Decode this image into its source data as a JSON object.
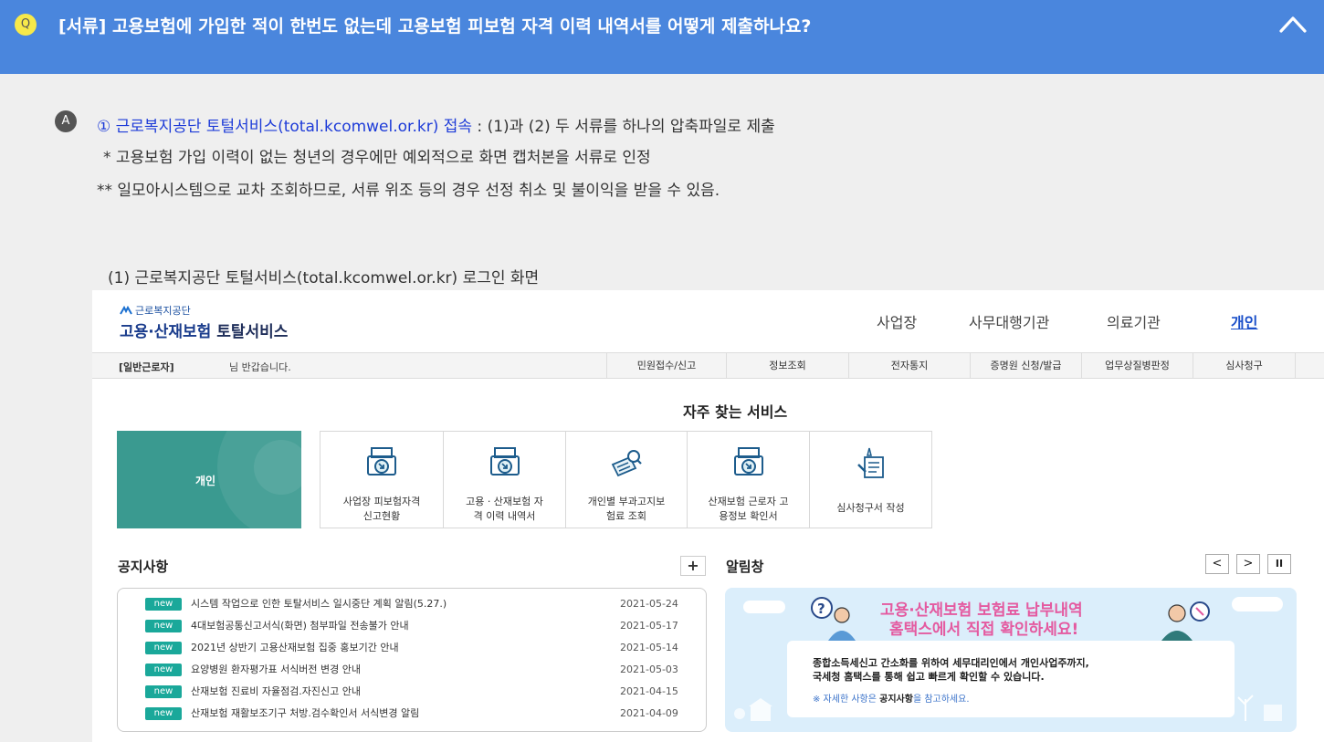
{
  "question": {
    "badge": "Q",
    "text": "[서류] 고용보험에 가입한 적이 한번도 없는데 고용보험 피보험 자격 이력 내역서를 어떻게 제출하나요?",
    "toggle_icon": "chevron-up-icon"
  },
  "answer": {
    "badge": "A",
    "line1_link": "① 근로복지공단 토털서비스(total.kcomwel.or.kr) 접속",
    "line1_rest": " : (1)과 (2) 두 서류를 하나의 압축파일로 제출",
    "line2": "* 고용보험 가입 이력이 없는 청년의 경우에만 예외적으로 화면 캡처본을 서류로 인정",
    "line3": "** 일모아시스템으로 교차 조회하므로, 서류 위조 등의 경우 선정 취소 및 불이익을 받을 수 있음.",
    "caption": "(1) 근로복지공단 토털서비스(total.kcomwel.or.kr) 로그인 화면"
  },
  "site": {
    "logo_small": "근로복지공단",
    "logo_main_a": "고용·산재보험",
    "logo_main_b": "토탈서비스",
    "top_nav": [
      "사업장",
      "사무대행기관",
      "의료기관",
      "개인"
    ],
    "greeting_user": "[일반근로자]",
    "greeting_text": "님 반갑습니다.",
    "menu": [
      "민원접수/신고",
      "정보조회",
      "전자통지",
      "증명원 신청/발급",
      "업무상질병판정",
      "심사청구"
    ],
    "services_title": "자주 찾는 서비스",
    "personal_label": "개인",
    "services": [
      {
        "line1": "사업장 피보험자격",
        "line2": "신고현황",
        "icon": "printer-icon"
      },
      {
        "line1": "고용 · 산재보험 자",
        "line2": "격 이력 내역서",
        "icon": "printer-icon"
      },
      {
        "line1": "개인별 부과고지보",
        "line2": "험료 조회",
        "icon": "document-search-icon"
      },
      {
        "line1": "산재보험 근로자 고",
        "line2": "용정보 확인서",
        "icon": "printer-icon"
      },
      {
        "line1": "심사청구서 작성",
        "line2": "",
        "icon": "writing-icon"
      }
    ],
    "notice_title": "공지사항",
    "notice_more": "+",
    "alert_title": "알림창",
    "alert_controls": [
      "<",
      ">",
      "II"
    ],
    "new_badge": "new",
    "notices": [
      {
        "text": "시스템 작업으로 인한 토탈서비스 일시중단 계획 알림(5.27.)",
        "date": "2021-05-24"
      },
      {
        "text": "4대보험공통신고서식(화면) 첨부파일 전송불가 안내",
        "date": "2021-05-17"
      },
      {
        "text": "2021년 상반기 고용산재보험 집중 홍보기간 안내",
        "date": "2021-05-14"
      },
      {
        "text": "요양병원 환자평가표 서식버전 변경 안내",
        "date": "2021-05-03"
      },
      {
        "text": "산재보험 진료비 자율점검.자진신고 안내",
        "date": "2021-04-15"
      },
      {
        "text": "산재보험 재활보조기구 처방.검수확인서 서식변경 알림",
        "date": "2021-04-09"
      }
    ],
    "banner": {
      "headline1": "고용·산재보험 보험료 납부내역",
      "headline2": "홈택스에서 직접 확인하세요!",
      "body1": "종합소득세신고 간소화를 위하여 세무대리인에서 개인사업주까지,",
      "body2": "국세청 홈택스를 통해 쉽고 빠르게 확인할 수 있습니다.",
      "note_pre": "※ 자세한 사항은 ",
      "note_bold": "공지사항",
      "note_post": "을 참고하세요."
    }
  },
  "colors": {
    "question_bar": "#4a86dd",
    "q_badge": "#f7e94a",
    "link": "#1d3bd8",
    "teal": "#3a9a90",
    "new_badge": "#1aa89a",
    "banner_pink": "#e45aa0"
  }
}
